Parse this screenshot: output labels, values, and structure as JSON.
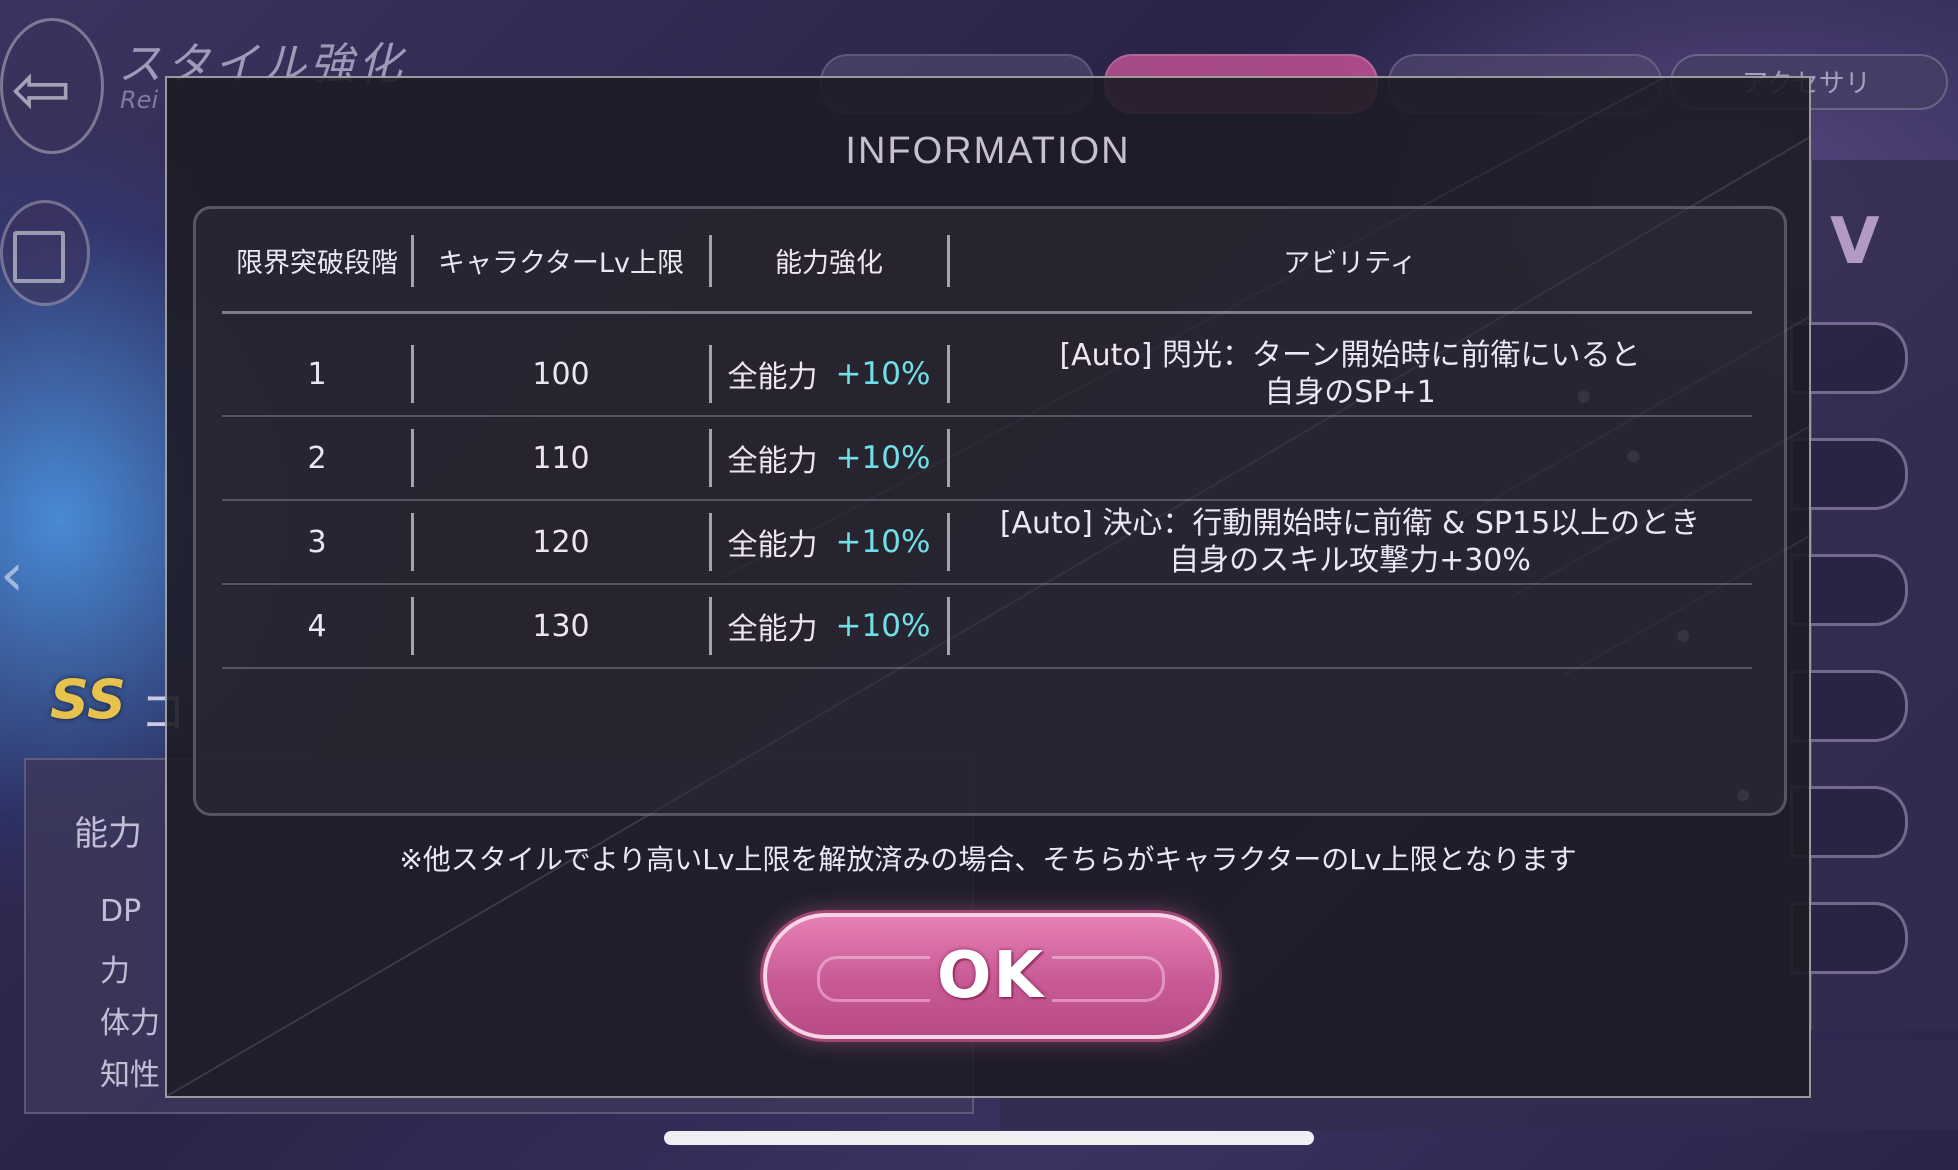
{
  "background": {
    "screen_title": "スタイル強化",
    "screen_subtitle": "Rei",
    "accessory_tab": "アクセサリ",
    "right_panel_initial": "V",
    "rank_badge": "SS",
    "name_initial": "コ",
    "stats_heading": "能力",
    "stats": [
      "DP",
      "力",
      "体力",
      "知性"
    ]
  },
  "dialog": {
    "title": "INFORMATION",
    "headers": {
      "stage": "限界突破段階",
      "level_cap": "キャラクターLv上限",
      "enhance": "能力強化",
      "ability": "アビリティ"
    },
    "rows": [
      {
        "stage": "1",
        "level_cap": "100",
        "enhance_label": "全能力",
        "enhance_value": "+10%",
        "ability_line1": "[Auto] 閃光：ターン開始時に前衛にいると",
        "ability_line2": "自身のSP+1"
      },
      {
        "stage": "2",
        "level_cap": "110",
        "enhance_label": "全能力",
        "enhance_value": "+10%",
        "ability_line1": "",
        "ability_line2": ""
      },
      {
        "stage": "3",
        "level_cap": "120",
        "enhance_label": "全能力",
        "enhance_value": "+10%",
        "ability_line1": "[Auto] 決心：行動開始時に前衛 & SP15以上のとき",
        "ability_line2": "自身のスキル攻撃力+30%"
      },
      {
        "stage": "4",
        "level_cap": "130",
        "enhance_label": "全能力",
        "enhance_value": "+10%",
        "ability_line1": "",
        "ability_line2": ""
      }
    ],
    "note": "※他スタイルでより高いLv上限を解放済みの場合、そちらがキャラクターのLv上限となります",
    "ok_label": "OK"
  },
  "colors": {
    "bonus": "#6fe0e6",
    "ok_button": "#d46aa3",
    "dialog_bg": "#1e1c26"
  }
}
